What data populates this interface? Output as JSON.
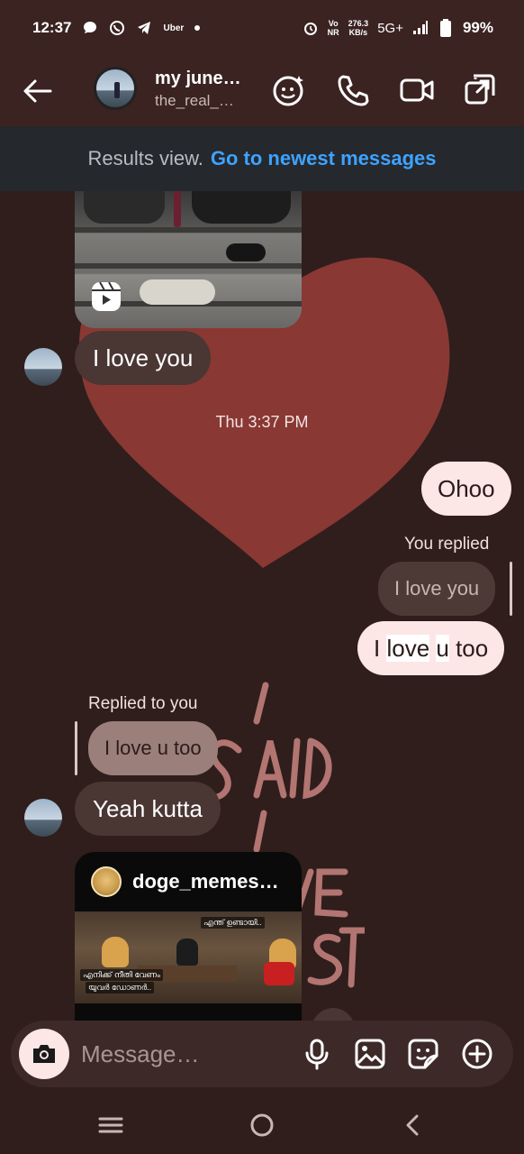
{
  "status_bar": {
    "time": "12:37",
    "uber_label": "Uber",
    "net_speed_top": "276.3",
    "net_speed_bottom": "KB/s",
    "volte_top": "Vo",
    "volte_bottom": "NR",
    "network": "5G+",
    "battery": "99%"
  },
  "header": {
    "chat_name": "my june…",
    "username": "the_real_…"
  },
  "results_bar": {
    "label": "Results view.",
    "link": "Go to newest messages"
  },
  "messages": {
    "incoming_1": "I love you",
    "timestamp": "Thu 3:37 PM",
    "outgoing_1": "Ohoo",
    "you_replied_label": "You replied",
    "quoted_1": "I love you",
    "outgoing_2_parts": [
      "I ",
      "love",
      " ",
      "u",
      " too"
    ],
    "replied_to_you_label": "Replied to you",
    "quoted_2": "I love u too",
    "incoming_2": "Yeah kutta",
    "shared_post_user": "doge_memes…",
    "post_caption_left": "എനിക്ക് നീതി വേണം",
    "post_caption_left2": "യുവർ ഡോണർ..",
    "post_caption_right": "എന്ത് ഉണ്ടായി.."
  },
  "composer": {
    "placeholder": "Message…"
  },
  "colors": {
    "background": "#2f1e1c",
    "header": "#3a2321",
    "link_blue": "#3ea3ff",
    "outgoing_bubble": "#fde6e6",
    "incoming_bubble": "#4a3633",
    "heart": "#8e3a36"
  }
}
